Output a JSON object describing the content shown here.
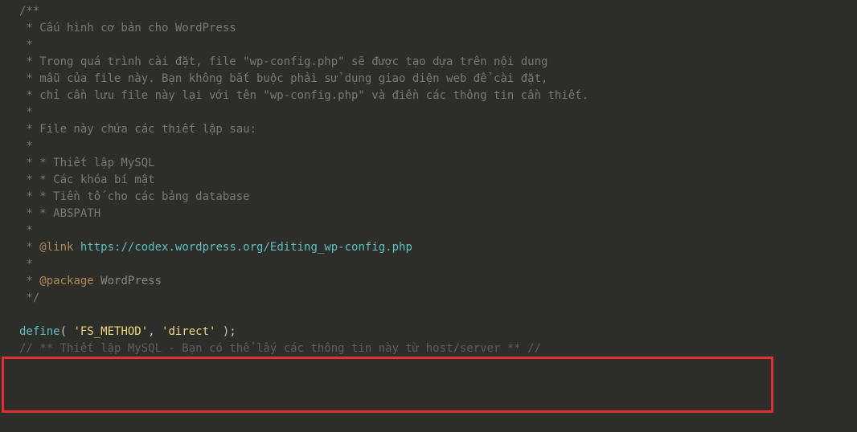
{
  "code": {
    "lines": [
      {
        "type": "comment",
        "text": "/**"
      },
      {
        "type": "comment",
        "text": " * Cấu hình cơ bản cho WordPress"
      },
      {
        "type": "comment",
        "text": " *"
      },
      {
        "type": "comment",
        "text": " * Trong quá trình cài đặt, file \"wp-config.php\" sẽ được tạo dựa trên nội dung"
      },
      {
        "type": "comment",
        "text": " * mẫu của file này. Bạn không bắt buộc phải sử dụng giao diện web để cài đặt,"
      },
      {
        "type": "comment",
        "text": " * chỉ cần lưu file này lại với tên \"wp-config.php\" và điền các thông tin cần thiết."
      },
      {
        "type": "comment",
        "text": " *"
      },
      {
        "type": "comment",
        "text": " * File này chứa các thiết lập sau:"
      },
      {
        "type": "comment",
        "text": " *"
      },
      {
        "type": "comment",
        "text": " * * Thiết lập MySQL"
      },
      {
        "type": "comment",
        "text": " * * Các khóa bí mật"
      },
      {
        "type": "comment",
        "text": " * * Tiền tố cho các bảng database"
      },
      {
        "type": "comment",
        "text": " * * ABSPATH"
      },
      {
        "type": "comment",
        "text": " *"
      },
      {
        "type": "link-line",
        "prefix": " * ",
        "tag": "@link",
        "url": "https://codex.wordpress.org/Editing_wp-config.php"
      },
      {
        "type": "comment",
        "text": " *"
      },
      {
        "type": "package-line",
        "prefix": " * ",
        "tag": "@package",
        "name": "WordPress"
      },
      {
        "type": "comment",
        "text": " */"
      },
      {
        "type": "blank",
        "text": ""
      },
      {
        "type": "code-define",
        "keyword": "define",
        "open": "( ",
        "arg1": "'FS_METHOD'",
        "comma": ", ",
        "arg2": "'direct'",
        "close": " );"
      },
      {
        "type": "comment-dim",
        "text": "// ** Thiết lập MySQL - Bạn có thể lấy các thông tin này từ host/server ** //"
      }
    ]
  }
}
